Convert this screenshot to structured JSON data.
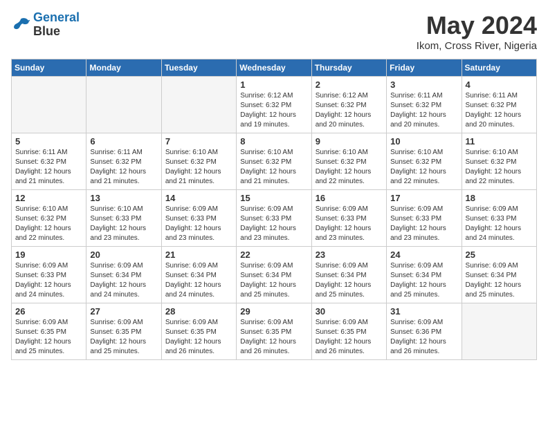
{
  "header": {
    "logo_line1": "General",
    "logo_line2": "Blue",
    "month_title": "May 2024",
    "subtitle": "Ikom, Cross River, Nigeria"
  },
  "weekdays": [
    "Sunday",
    "Monday",
    "Tuesday",
    "Wednesday",
    "Thursday",
    "Friday",
    "Saturday"
  ],
  "weeks": [
    [
      {
        "day": "",
        "info": ""
      },
      {
        "day": "",
        "info": ""
      },
      {
        "day": "",
        "info": ""
      },
      {
        "day": "1",
        "info": "Sunrise: 6:12 AM\nSunset: 6:32 PM\nDaylight: 12 hours\nand 19 minutes."
      },
      {
        "day": "2",
        "info": "Sunrise: 6:12 AM\nSunset: 6:32 PM\nDaylight: 12 hours\nand 20 minutes."
      },
      {
        "day": "3",
        "info": "Sunrise: 6:11 AM\nSunset: 6:32 PM\nDaylight: 12 hours\nand 20 minutes."
      },
      {
        "day": "4",
        "info": "Sunrise: 6:11 AM\nSunset: 6:32 PM\nDaylight: 12 hours\nand 20 minutes."
      }
    ],
    [
      {
        "day": "5",
        "info": "Sunrise: 6:11 AM\nSunset: 6:32 PM\nDaylight: 12 hours\nand 21 minutes."
      },
      {
        "day": "6",
        "info": "Sunrise: 6:11 AM\nSunset: 6:32 PM\nDaylight: 12 hours\nand 21 minutes."
      },
      {
        "day": "7",
        "info": "Sunrise: 6:10 AM\nSunset: 6:32 PM\nDaylight: 12 hours\nand 21 minutes."
      },
      {
        "day": "8",
        "info": "Sunrise: 6:10 AM\nSunset: 6:32 PM\nDaylight: 12 hours\nand 21 minutes."
      },
      {
        "day": "9",
        "info": "Sunrise: 6:10 AM\nSunset: 6:32 PM\nDaylight: 12 hours\nand 22 minutes."
      },
      {
        "day": "10",
        "info": "Sunrise: 6:10 AM\nSunset: 6:32 PM\nDaylight: 12 hours\nand 22 minutes."
      },
      {
        "day": "11",
        "info": "Sunrise: 6:10 AM\nSunset: 6:32 PM\nDaylight: 12 hours\nand 22 minutes."
      }
    ],
    [
      {
        "day": "12",
        "info": "Sunrise: 6:10 AM\nSunset: 6:32 PM\nDaylight: 12 hours\nand 22 minutes."
      },
      {
        "day": "13",
        "info": "Sunrise: 6:10 AM\nSunset: 6:33 PM\nDaylight: 12 hours\nand 23 minutes."
      },
      {
        "day": "14",
        "info": "Sunrise: 6:09 AM\nSunset: 6:33 PM\nDaylight: 12 hours\nand 23 minutes."
      },
      {
        "day": "15",
        "info": "Sunrise: 6:09 AM\nSunset: 6:33 PM\nDaylight: 12 hours\nand 23 minutes."
      },
      {
        "day": "16",
        "info": "Sunrise: 6:09 AM\nSunset: 6:33 PM\nDaylight: 12 hours\nand 23 minutes."
      },
      {
        "day": "17",
        "info": "Sunrise: 6:09 AM\nSunset: 6:33 PM\nDaylight: 12 hours\nand 23 minutes."
      },
      {
        "day": "18",
        "info": "Sunrise: 6:09 AM\nSunset: 6:33 PM\nDaylight: 12 hours\nand 24 minutes."
      }
    ],
    [
      {
        "day": "19",
        "info": "Sunrise: 6:09 AM\nSunset: 6:33 PM\nDaylight: 12 hours\nand 24 minutes."
      },
      {
        "day": "20",
        "info": "Sunrise: 6:09 AM\nSunset: 6:34 PM\nDaylight: 12 hours\nand 24 minutes."
      },
      {
        "day": "21",
        "info": "Sunrise: 6:09 AM\nSunset: 6:34 PM\nDaylight: 12 hours\nand 24 minutes."
      },
      {
        "day": "22",
        "info": "Sunrise: 6:09 AM\nSunset: 6:34 PM\nDaylight: 12 hours\nand 25 minutes."
      },
      {
        "day": "23",
        "info": "Sunrise: 6:09 AM\nSunset: 6:34 PM\nDaylight: 12 hours\nand 25 minutes."
      },
      {
        "day": "24",
        "info": "Sunrise: 6:09 AM\nSunset: 6:34 PM\nDaylight: 12 hours\nand 25 minutes."
      },
      {
        "day": "25",
        "info": "Sunrise: 6:09 AM\nSunset: 6:34 PM\nDaylight: 12 hours\nand 25 minutes."
      }
    ],
    [
      {
        "day": "26",
        "info": "Sunrise: 6:09 AM\nSunset: 6:35 PM\nDaylight: 12 hours\nand 25 minutes."
      },
      {
        "day": "27",
        "info": "Sunrise: 6:09 AM\nSunset: 6:35 PM\nDaylight: 12 hours\nand 25 minutes."
      },
      {
        "day": "28",
        "info": "Sunrise: 6:09 AM\nSunset: 6:35 PM\nDaylight: 12 hours\nand 26 minutes."
      },
      {
        "day": "29",
        "info": "Sunrise: 6:09 AM\nSunset: 6:35 PM\nDaylight: 12 hours\nand 26 minutes."
      },
      {
        "day": "30",
        "info": "Sunrise: 6:09 AM\nSunset: 6:35 PM\nDaylight: 12 hours\nand 26 minutes."
      },
      {
        "day": "31",
        "info": "Sunrise: 6:09 AM\nSunset: 6:36 PM\nDaylight: 12 hours\nand 26 minutes."
      },
      {
        "day": "",
        "info": ""
      }
    ]
  ]
}
